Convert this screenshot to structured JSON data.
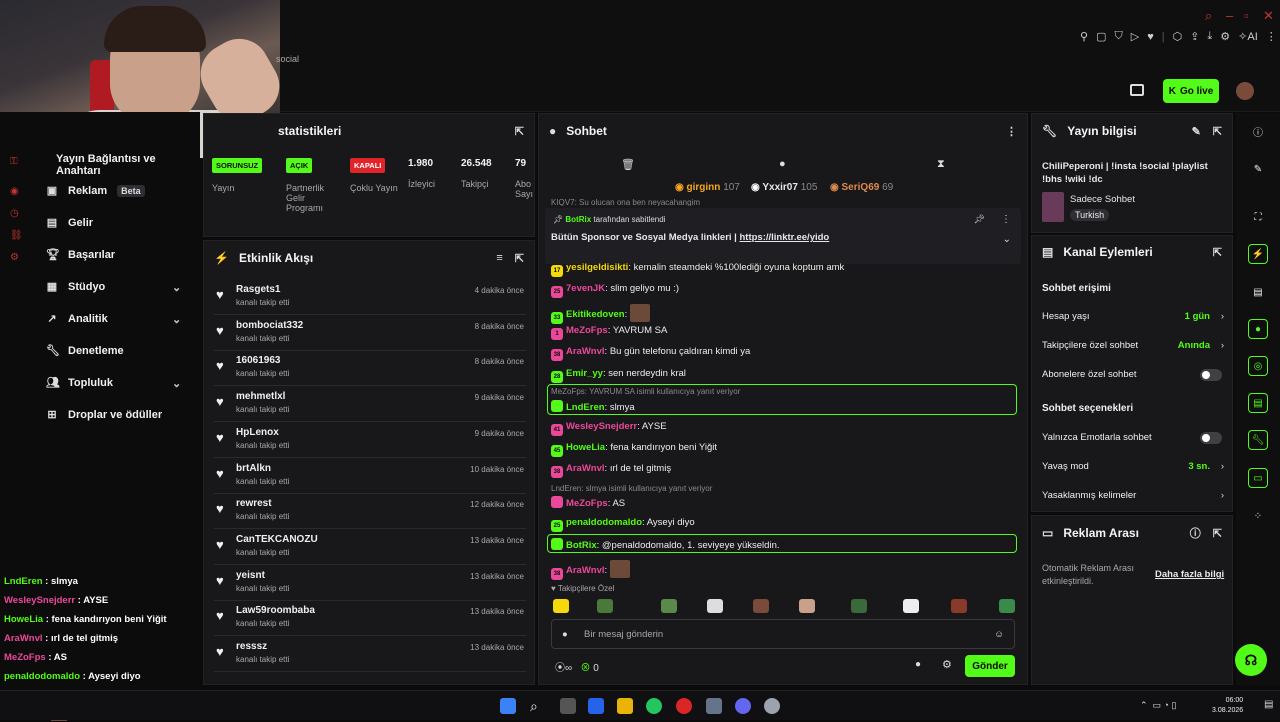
{
  "overlay_top": {
    "social": "social"
  },
  "header": {
    "go_live": "Go live"
  },
  "sidebar": {
    "partial_top": "Yayın Bağlantısı ve Anahtarı",
    "items": [
      {
        "label": "Reklam",
        "badge": "Beta"
      },
      {
        "label": "Gelir"
      },
      {
        "label": "Başarılar"
      },
      {
        "label": "Stüdyo"
      },
      {
        "label": "Analitik"
      },
      {
        "label": "Denetleme"
      },
      {
        "label": "Topluluk"
      },
      {
        "label": "Droplar ve ödüller"
      }
    ]
  },
  "stats": {
    "title": "statistikleri",
    "cells": [
      {
        "badge": "SORUNSUZ",
        "label": "Yayın"
      },
      {
        "badge": "AÇIK",
        "label": "Partnerlik Gelir Programı"
      },
      {
        "badge": "KAPALI",
        "label": "Çoklu Yayın"
      },
      {
        "value": "1.980",
        "label": "İzleyici"
      },
      {
        "value": "26.548",
        "label": "Takipçi"
      },
      {
        "value": "79",
        "label": "Abo Sayı"
      }
    ]
  },
  "activity": {
    "title": "Etkinlik Akışı",
    "sub": "kanalı takip etti",
    "rows": [
      {
        "name": "Rasgets1",
        "time": "4 dakika önce"
      },
      {
        "name": "bombociat332",
        "time": "8 dakika önce"
      },
      {
        "name": "16061963",
        "time": "8 dakika önce"
      },
      {
        "name": "mehmetlxl",
        "time": "9 dakika önce"
      },
      {
        "name": "HpLenox",
        "time": "9 dakika önce"
      },
      {
        "name": "brtAlkn",
        "time": "10 dakika önce"
      },
      {
        "name": "rewrest",
        "time": "12 dakika önce"
      },
      {
        "name": "CanTEKCANOZU",
        "time": "13 dakika önce"
      },
      {
        "name": "yeisnt",
        "time": "13 dakika önce"
      },
      {
        "name": "Law59roombaba",
        "time": "13 dakika önce"
      },
      {
        "name": "resssz",
        "time": "13 dakika önce"
      }
    ]
  },
  "chat": {
    "title": "Sohbet",
    "top_donors": [
      {
        "name": "girginn",
        "count": "107",
        "color": "#f5a623"
      },
      {
        "name": "Yxxir07",
        "count": "105",
        "color": "#ffffff"
      },
      {
        "name": "SeriQ69",
        "count": "69",
        "color": "#e08a4a"
      }
    ],
    "cutoff": "KIQV7: Su olucan ona ben neyacahangim",
    "pinned_by": "BotRix",
    "pinned_by_suffix": "tarafından sabitlendi",
    "pinned_text": "Bütün Sponsor ve Sosyal Medya linkleri |",
    "pinned_link": "https://linktr.ee/yido",
    "messages": [
      {
        "lvl": "17",
        "user": "yesilgeldisikti",
        "text": "kemalin steamdeki %100lediği oyuna koptum amk",
        "color": "#f5d90a"
      },
      {
        "lvl": "25",
        "user": "7evenJK",
        "text": "slim geliyo mu :)",
        "color": "#ec4899"
      },
      {
        "lvl": "33",
        "user": "Ekitikedoven",
        "text": "",
        "color": "#53fc18"
      },
      {
        "lvl": "1",
        "user": "MeZoFps",
        "text": "YAVRUM SA",
        "color": "#ec4899"
      },
      {
        "lvl": "38",
        "user": "AraWnvl",
        "text": "Bu gün telefonu çaldıran kimdi ya",
        "color": "#ec4899"
      },
      {
        "lvl": "28",
        "user": "Emir_yy",
        "text": "sen nerdeydin kral",
        "color": "#53fc18"
      },
      {
        "reply": "MeZoFps: YAVRUM SA isimli kullanıcıya yanıt veriyor",
        "user": "LndEren",
        "text": "slmya",
        "color": "#53fc18"
      },
      {
        "lvl": "41",
        "user": "WesleySnejderr",
        "text": "AYSE",
        "color": "#ec4899"
      },
      {
        "lvl": "45",
        "user": "HoweLia",
        "text": "fena kandırıyon beni Yiğit",
        "color": "#53fc18"
      },
      {
        "lvl": "38",
        "user": "AraWnvl",
        "text": "ırl de tel gitmiş",
        "color": "#ec4899"
      },
      {
        "reply": "LndEren: slmya isimli kullanıcıya yanıt veriyor",
        "user": "MeZoFps",
        "text": "AS",
        "color": "#ec4899"
      },
      {
        "lvl": "25",
        "user": "penaldodomaldo",
        "text": "Ayseyi diyo",
        "color": "#53fc18"
      },
      {
        "user": "BotRix",
        "text": "@penaldodomaldo, 1. seviyeye yükseldin.",
        "color": "#53fc18"
      },
      {
        "lvl": "38",
        "user": "AraWnvl",
        "text": "",
        "color": "#ec4899"
      }
    ],
    "followers_only": "Takipçilere Özel",
    "input_placeholder": "Bir mesaj gönderin",
    "points": "0",
    "send": "Gönder"
  },
  "stream_info": {
    "title": "Yayın bilgisi",
    "stream_title": "ChiliPeperoni | !insta !social !playlist !bhs !wiki !dc",
    "category": "Sadece Sohbet",
    "language": "Turkish"
  },
  "channel_actions": {
    "title": "Kanal Eylemleri",
    "section1": "Sohbet erişimi",
    "rows1": [
      {
        "label": "Hesap yaşı",
        "value": "1 gün"
      },
      {
        "label": "Takipçilere özel sohbet",
        "value": "Anında"
      },
      {
        "label": "Abonelere özel sohbet"
      }
    ],
    "section2": "Sohbet seçenekleri",
    "rows2": [
      {
        "label": "Yalnızca Emotlarla sohbet"
      },
      {
        "label": "Yavaş mod",
        "value": "3 sn."
      },
      {
        "label": "Yasaklanmış kelimeler"
      }
    ]
  },
  "ad_break": {
    "title": "Reklam Arası",
    "text": "Otomatik Reklam Arası etkinleştirildi.",
    "link": "Daha fazla bilgi"
  },
  "overlay_chat": [
    {
      "user": "LndEren",
      "text": "slmya",
      "color": "#53fc18"
    },
    {
      "user": "WesleySnejderr",
      "text": "AYSE",
      "color": "#ec4899"
    },
    {
      "user": "HoweLia",
      "text": "fena kandırıyon beni Yiğit",
      "color": "#53fc18"
    },
    {
      "user": "AraWnvl",
      "text": "ırl de tel gitmiş",
      "color": "#ec4899"
    },
    {
      "user": "MeZoFps",
      "text": "AS",
      "color": "#ec4899"
    },
    {
      "user": "penaldodomaldo",
      "text": "Ayseyi diyo",
      "color": "#53fc18"
    },
    {
      "user": "BotRix",
      "text": "@penaldodomaldo, 1. seviyeye yi",
      "color": "#53fc18"
    },
    {
      "user": "AraWnvl",
      "text": "",
      "color": "#ec4899"
    }
  ],
  "taskbar": {
    "time": "06:00",
    "date": "3.08.2026"
  },
  "colors": {
    "accent": "#53fc18",
    "panel": "#18181b",
    "bg": "#0b0b0c",
    "danger": "#e0242a"
  }
}
